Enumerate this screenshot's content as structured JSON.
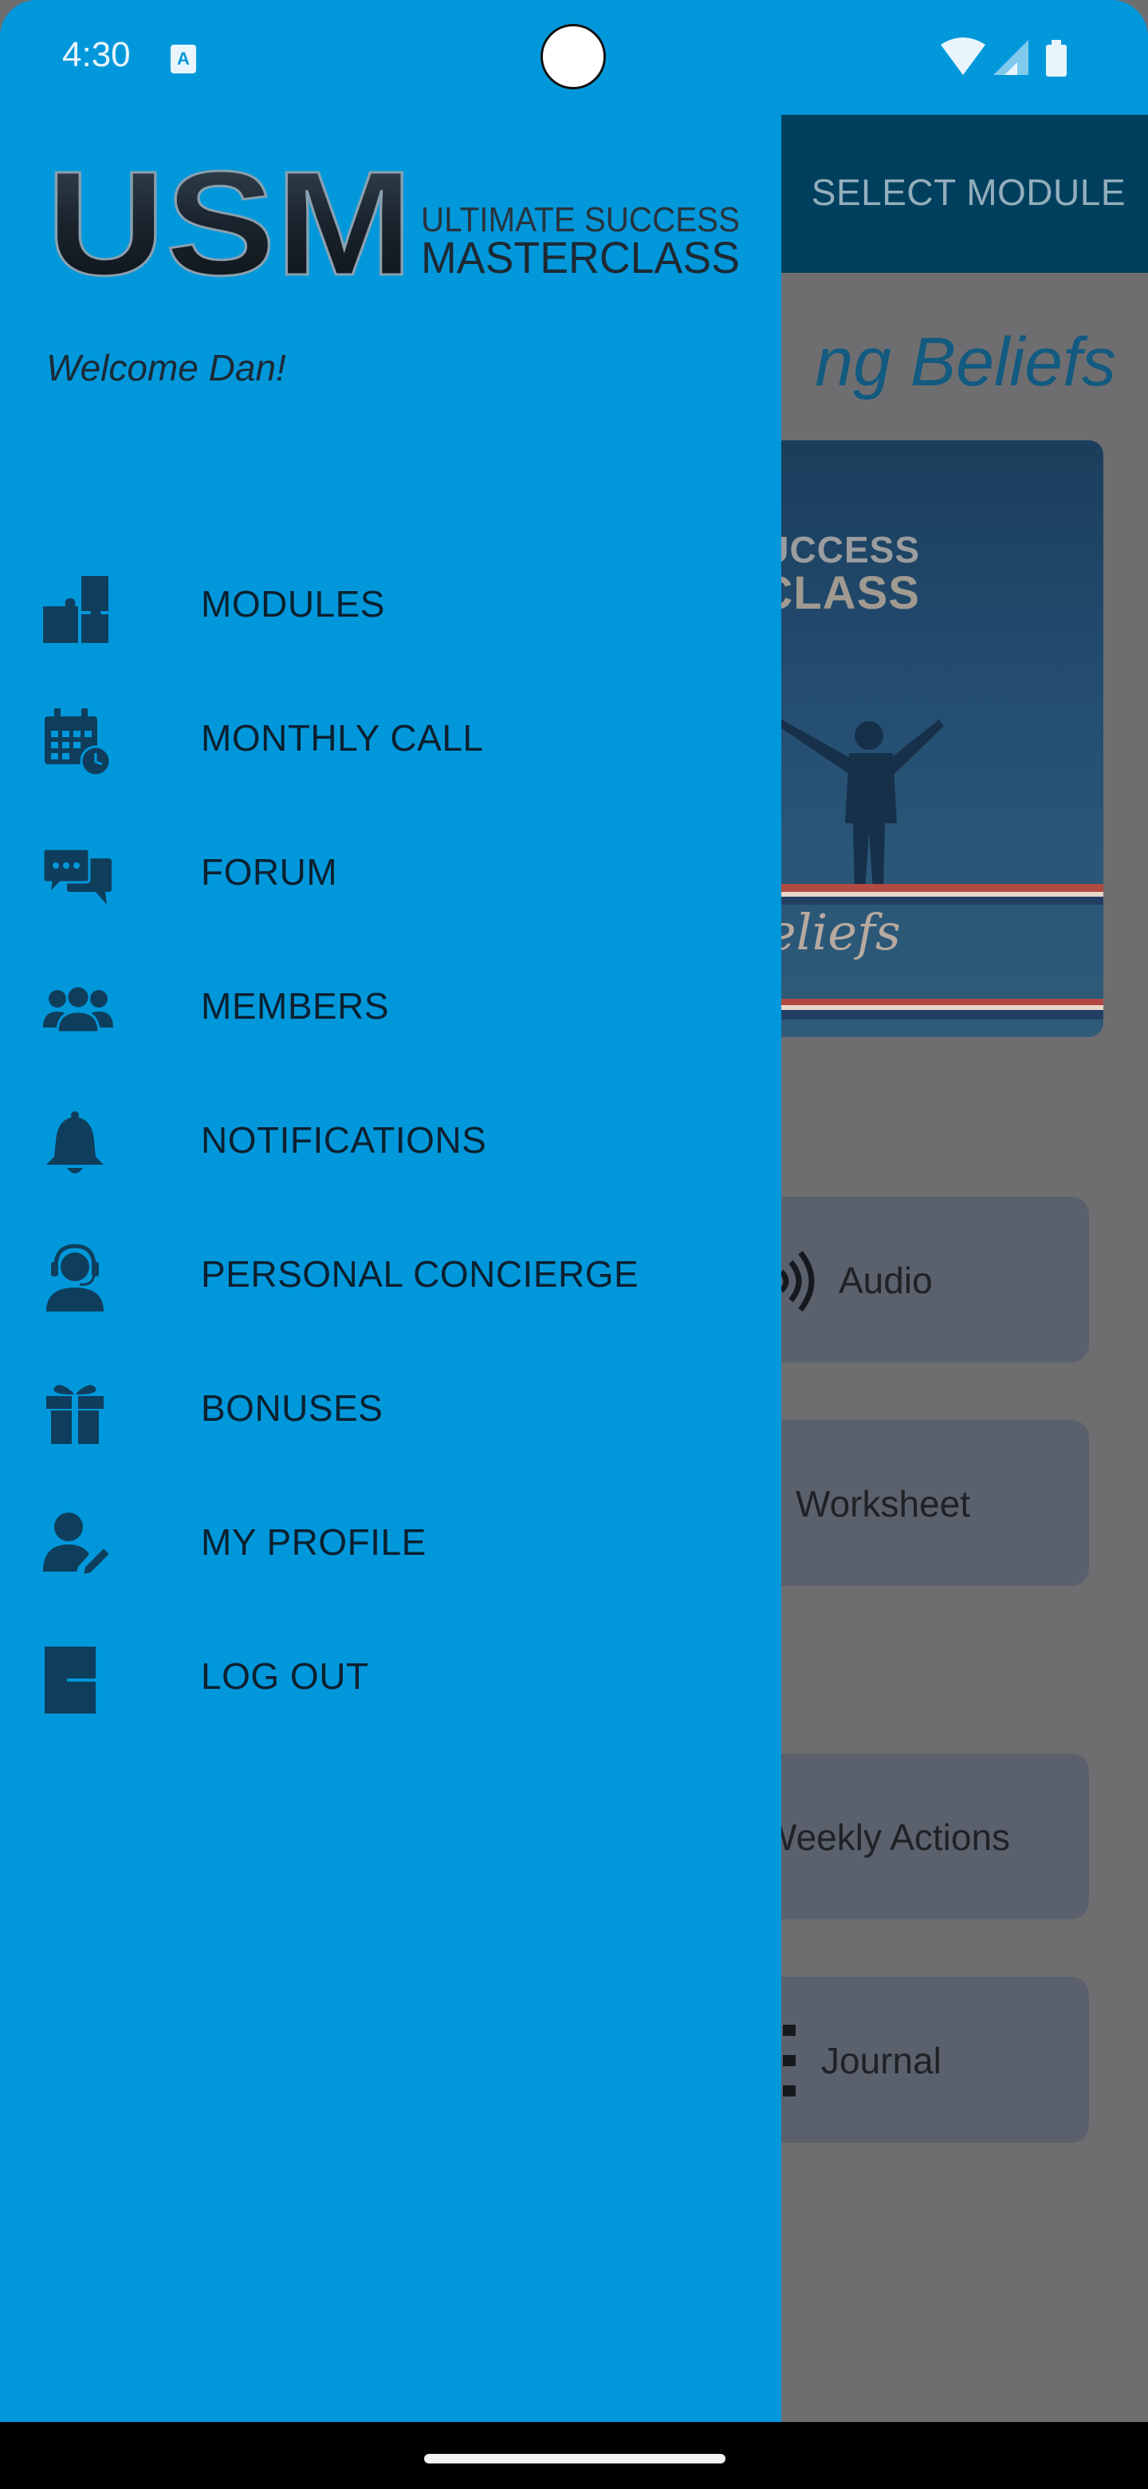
{
  "status_bar": {
    "time": "4:30",
    "notification_icon": "a-text-icon"
  },
  "background_screen": {
    "topbar_action": "SELECT MODULE",
    "module_title": "ng Beliefs",
    "image_text_line1": "SUCCESS",
    "image_text_line2": "CLASS",
    "image_script": "eliefs",
    "resources": [
      {
        "label": "Audio"
      },
      {
        "label": "Worksheet"
      },
      {
        "label": "Weekly Actions"
      },
      {
        "label": "Journal"
      }
    ]
  },
  "drawer": {
    "logo": {
      "letters": "USM",
      "line1": "ULTIMATE SUCCESS",
      "line2": "MASTERCLASS"
    },
    "welcome": "Welcome Dan!",
    "menu": [
      {
        "label": "MODULES",
        "icon": "puzzle-icon"
      },
      {
        "label": "MONTHLY CALL",
        "icon": "calendar-clock-icon"
      },
      {
        "label": "FORUM",
        "icon": "chat-bubbles-icon"
      },
      {
        "label": "MEMBERS",
        "icon": "users-icon"
      },
      {
        "label": "NOTIFICATIONS",
        "icon": "bell-icon"
      },
      {
        "label": "PERSONAL CONCIERGE",
        "icon": "headset-icon"
      },
      {
        "label": "BONUSES",
        "icon": "gift-icon"
      },
      {
        "label": "MY PROFILE",
        "icon": "user-edit-icon"
      },
      {
        "label": "LOG OUT",
        "icon": "logout-icon"
      }
    ]
  },
  "colors": {
    "drawer_bg": "#0098db",
    "icon_color": "#0f3e5c",
    "text_color": "#0c2030",
    "scrim_bg": "#6e6e70"
  }
}
